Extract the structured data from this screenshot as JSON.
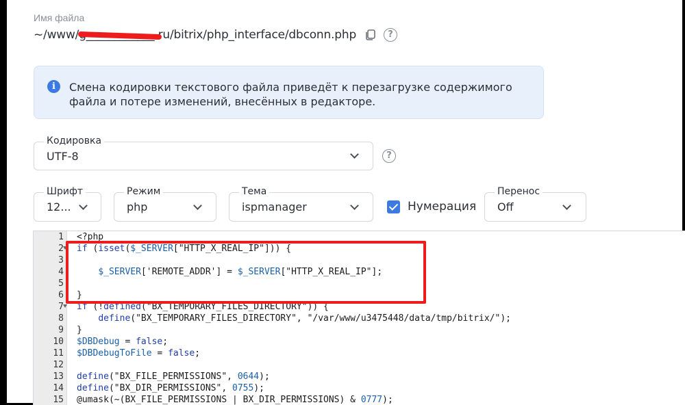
{
  "file": {
    "label": "Имя файла",
    "path_prefix": "~/www/",
    "path_hidden": "g____________",
    "path_suffix": ".ru/bitrix/php_interface/dbconn.php"
  },
  "info": {
    "text": "Смена кодировки текстового файла приведёт к перезагрузке содержимого файла и потере изменений, внесённых в редакторе."
  },
  "encoding": {
    "label": "Кодировка",
    "value": "UTF-8"
  },
  "font": {
    "label": "Шрифт",
    "value": "12..."
  },
  "mode": {
    "label": "Режим",
    "value": "php"
  },
  "theme": {
    "label": "Тема",
    "value": "ispmanager"
  },
  "numbering": {
    "label": "Нумерация",
    "checked": true
  },
  "wrap": {
    "label": "Перенос",
    "value": "Off"
  },
  "icons": {
    "copy": "copy-icon",
    "help": "help-icon",
    "info": "info-icon",
    "chevron": "chevron-down-icon"
  },
  "colors": {
    "accent": "#3b7ae0",
    "highlight": "#ee1d1d",
    "info_bg": "#e8f0fb"
  },
  "editor": {
    "lines": [
      {
        "n": "1",
        "text": "<?php",
        "fold": false
      },
      {
        "n": "2",
        "text": "if (isset($_SERVER[\"HTTP_X_REAL_IP\"])) {",
        "fold": true
      },
      {
        "n": "3",
        "text": "",
        "fold": false
      },
      {
        "n": "4",
        "text": "    $_SERVER['REMOTE_ADDR'] = $_SERVER[\"HTTP_X_REAL_IP\"];",
        "fold": false
      },
      {
        "n": "5",
        "text": "",
        "fold": false
      },
      {
        "n": "6",
        "text": "}",
        "fold": false
      },
      {
        "n": "7",
        "text": "if (!defined(\"BX_TEMPORARY_FILES_DIRECTORY\")) {",
        "fold": true
      },
      {
        "n": "8",
        "text": "    define(\"BX_TEMPORARY_FILES_DIRECTORY\", \"/var/www/u3475448/data/tmp/bitrix/\");",
        "fold": false
      },
      {
        "n": "9",
        "text": "}",
        "fold": false
      },
      {
        "n": "10",
        "text": "$DBDebug = false;",
        "fold": false
      },
      {
        "n": "11",
        "text": "$DBDebugToFile = false;",
        "fold": false
      },
      {
        "n": "12",
        "text": "",
        "fold": false
      },
      {
        "n": "13",
        "text": "define(\"BX_FILE_PERMISSIONS\", 0644);",
        "fold": false
      },
      {
        "n": "14",
        "text": "define(\"BX_DIR_PERMISSIONS\", 0755);",
        "fold": false
      },
      {
        "n": "15",
        "text": "@umask(~(BX_FILE_PERMISSIONS | BX_DIR_PERMISSIONS) & 0777);",
        "fold": false
      }
    ]
  }
}
